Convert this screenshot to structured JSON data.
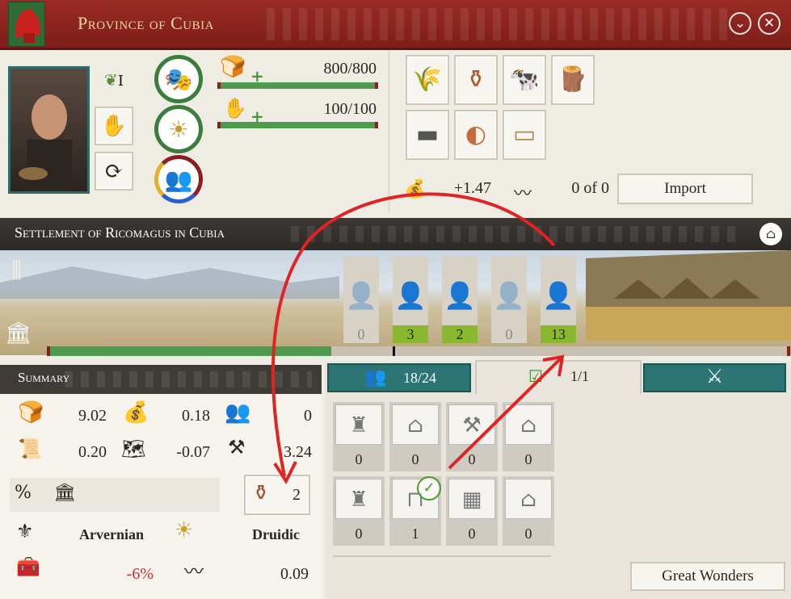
{
  "province": {
    "title": "Province of Cubia"
  },
  "governor": {
    "rank": "I"
  },
  "resources": {
    "food": "800/800",
    "influence": "100/100"
  },
  "trade": {
    "income": "+1.47",
    "routes": "0 of 0",
    "import_label": "Import"
  },
  "settlement": {
    "title": "Settlement of Ricomagus in Cubia"
  },
  "population": [
    {
      "count": "0"
    },
    {
      "count": "3"
    },
    {
      "count": "2"
    },
    {
      "count": "0"
    },
    {
      "count": "13"
    }
  ],
  "summary": {
    "title": "Summary",
    "stats": [
      [
        "9.02",
        "0.18",
        "0"
      ],
      [
        "0.20",
        "-0.07",
        "3.24"
      ]
    ],
    "amphora_count": "2",
    "culture": "Arvernian",
    "religion": "Druidic",
    "percent": "-6%",
    "trade_value": "0.09"
  },
  "tabs": {
    "pop_tab": "18/24",
    "building_tab": "1/1"
  },
  "buildings": {
    "row1": [
      "0",
      "0",
      "0",
      "0"
    ],
    "row2": [
      "0",
      "1",
      "0",
      "0"
    ]
  },
  "great_wonders_label": "Great Wonders",
  "icons": {
    "close": "close-icon",
    "collapse": "chevron-down-icon"
  },
  "colors": {
    "header": "#8b231f",
    "teal": "#2c7574",
    "green": "#4e9a4e",
    "annotation": "#e02424"
  }
}
